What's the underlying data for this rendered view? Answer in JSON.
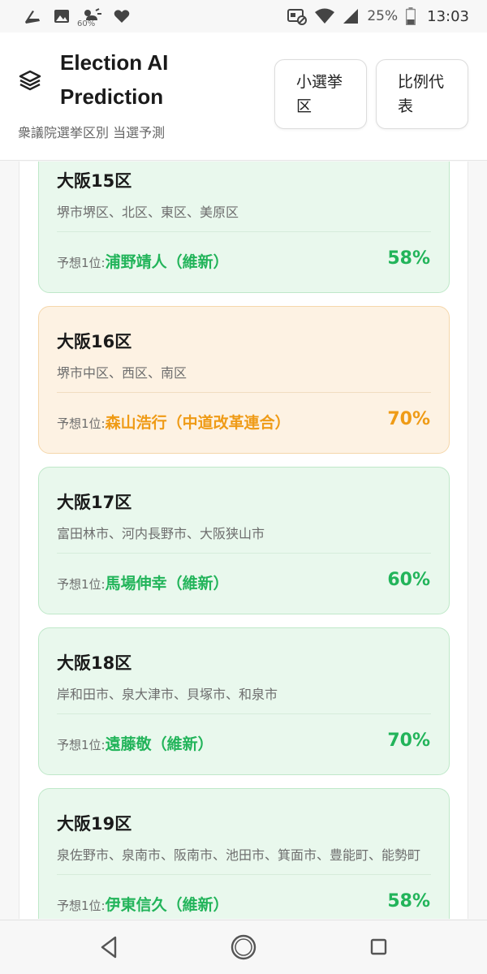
{
  "status_bar": {
    "weather_pct": "60%",
    "battery_pct": "25%",
    "time": "13:03"
  },
  "header": {
    "title": "Election AI Prediction",
    "subtitle": "衆議院選挙区別 当選予測",
    "mode_buttons": [
      {
        "label": "小選挙区"
      },
      {
        "label": "比例代表"
      }
    ]
  },
  "prediction_label": "予想1位:",
  "districts": [
    {
      "name": "大阪15区",
      "areas": "堺市堺区、北区、東区、美原区",
      "candidate": "浦野靖人（維新）",
      "probability": "58%",
      "color": "green"
    },
    {
      "name": "大阪16区",
      "areas": "堺市中区、西区、南区",
      "candidate": "森山浩行（中道改革連合）",
      "probability": "70%",
      "color": "orange"
    },
    {
      "name": "大阪17区",
      "areas": "富田林市、河内長野市、大阪狭山市",
      "candidate": "馬場伸幸（維新）",
      "probability": "60%",
      "color": "green"
    },
    {
      "name": "大阪18区",
      "areas": "岸和田市、泉大津市、貝塚市、和泉市",
      "candidate": "遠藤敬（維新）",
      "probability": "70%",
      "color": "green"
    },
    {
      "name": "大阪19区",
      "areas": "泉佐野市、泉南市、阪南市、池田市、箕面市、豊能町、能勢町",
      "candidate": "伊東信久（維新）",
      "probability": "58%",
      "color": "green"
    }
  ],
  "colors": {
    "green_accent": "#22b45a",
    "orange_accent": "#ef9b16",
    "green_card_bg": "#e9f8ed",
    "orange_card_bg": "#fdf2e3"
  },
  "icons": {
    "logo": "layers-icon",
    "nav": [
      "back-icon",
      "home-icon",
      "recents-icon"
    ]
  }
}
